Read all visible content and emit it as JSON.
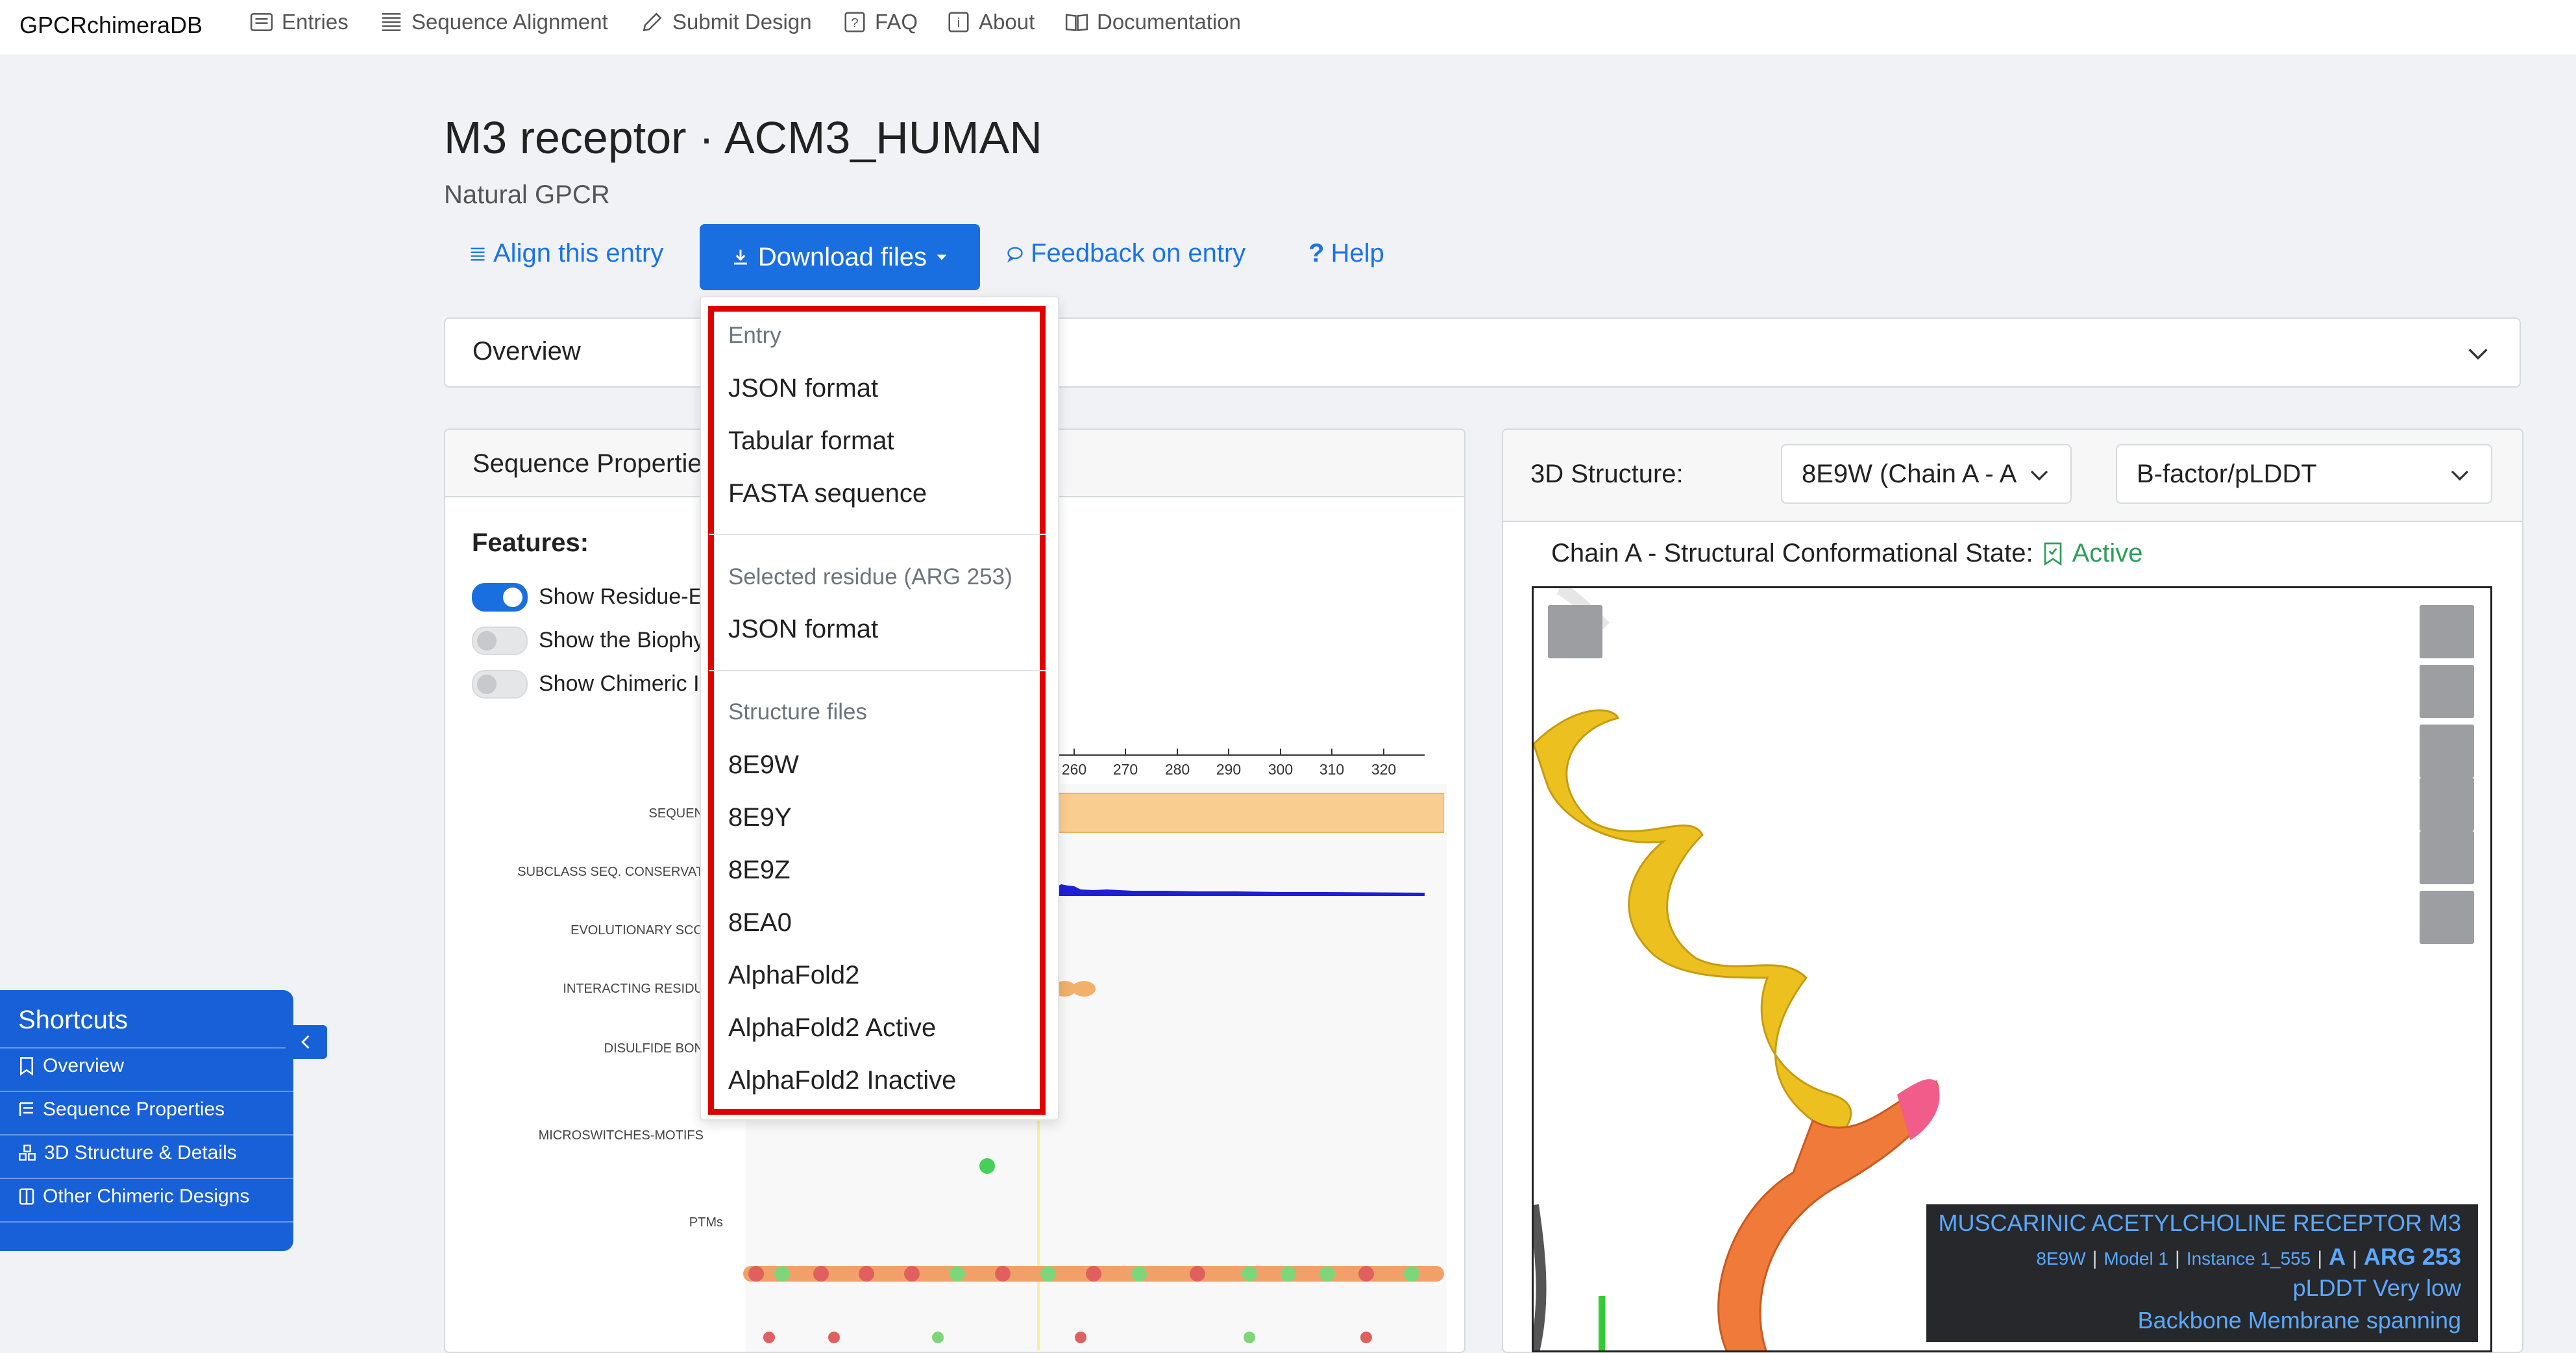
{
  "nav": {
    "brand": "GPCRchimeraDB",
    "items": [
      {
        "label": "Entries",
        "icon": "list-icon"
      },
      {
        "label": "Sequence Alignment",
        "icon": "alignment-icon"
      },
      {
        "label": "Submit Design",
        "icon": "pencil-icon"
      },
      {
        "label": "FAQ",
        "icon": "question-icon"
      },
      {
        "label": "About",
        "icon": "info-icon"
      },
      {
        "label": "Documentation",
        "icon": "book-icon"
      }
    ]
  },
  "entry": {
    "title": "M3 receptor · ACM3_HUMAN",
    "subtitle": "Natural GPCR"
  },
  "actions": {
    "align": "Align this entry",
    "download": "Download files",
    "feedback": "Feedback on entry",
    "help": "Help"
  },
  "dropdown": {
    "sections": [
      {
        "header": "Entry",
        "items": [
          "JSON format",
          "Tabular format",
          "FASTA sequence"
        ]
      },
      {
        "header": "Selected residue (ARG 253)",
        "items": [
          "JSON format"
        ]
      },
      {
        "header": "Structure files",
        "items": [
          "8E9W",
          "8E9Y",
          "8E9Z",
          "8EA0",
          "AlphaFold2",
          "AlphaFold2 Active",
          "AlphaFold2 Inactive"
        ]
      }
    ]
  },
  "overview": {
    "label": "Overview"
  },
  "sequence_panel": {
    "title": "Sequence Propertie",
    "features_label": "Features:",
    "toggles": [
      {
        "label": "Show Residue-E",
        "on": true
      },
      {
        "label": "Show the Biophy",
        "on": false
      },
      {
        "label": "Show Chimeric I",
        "on": false
      }
    ],
    "axis_ticks": [
      "260",
      "270",
      "280",
      "290",
      "300",
      "310",
      "320"
    ],
    "tracks": [
      "SEQUEN",
      "SUBCLASS SEQ. CONSERVAT",
      "EVOLUTIONARY SCO",
      "INTERACTING RESIDU",
      "DISULFIDE BON",
      "MICROSWITCHES-MOTIFS",
      "PTMs"
    ]
  },
  "structure_panel": {
    "label": "3D Structure:",
    "structure_select": "8E9W (Chain A - A",
    "color_select": "B-factor/pLDDT",
    "state_label": "Chain A - Structural Conformational State:",
    "state_value": "Active",
    "info": {
      "protein": "MUSCARINIC ACETYLCHOLINE RECEPTOR M3",
      "pdb": "8E9W",
      "model": "Model 1",
      "instance": "Instance 1_555",
      "chain": "A",
      "residue": "ARG 253",
      "plddt": "pLDDT Very low",
      "region": "Backbone Membrane spanning"
    }
  },
  "shortcuts": {
    "title": "Shortcuts",
    "items": [
      "Overview",
      "Sequence Properties",
      "3D Structure & Details",
      "Other Chimeric Designs"
    ]
  },
  "colors": {
    "accent": "#1a6fe0",
    "highlight_border": "#e00000",
    "active_state": "#2e9e5b",
    "helix_yellow": "#f0c419",
    "helix_orange": "#f07a3a"
  }
}
